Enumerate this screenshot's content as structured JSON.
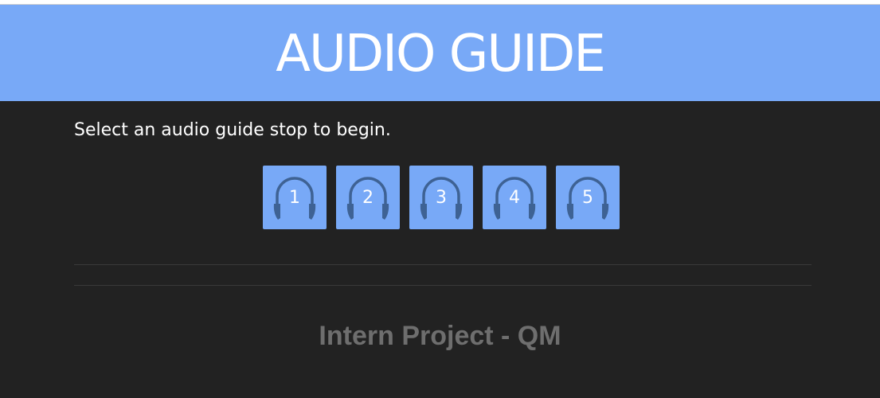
{
  "header": {
    "title": "AUDIO GUIDE"
  },
  "main": {
    "instruction": "Select an audio guide stop to begin.",
    "stops": [
      {
        "label": "1",
        "icon": "headphones-icon"
      },
      {
        "label": "2",
        "icon": "headphones-icon"
      },
      {
        "label": "3",
        "icon": "headphones-icon"
      },
      {
        "label": "4",
        "icon": "headphones-icon"
      },
      {
        "label": "5",
        "icon": "headphones-icon"
      }
    ]
  },
  "footer": {
    "text": "Intern Project - QM"
  },
  "colors": {
    "accent": "#78a9f7",
    "background": "#222222",
    "icon": "#3e6294",
    "footer_text": "#6e6e6e"
  }
}
